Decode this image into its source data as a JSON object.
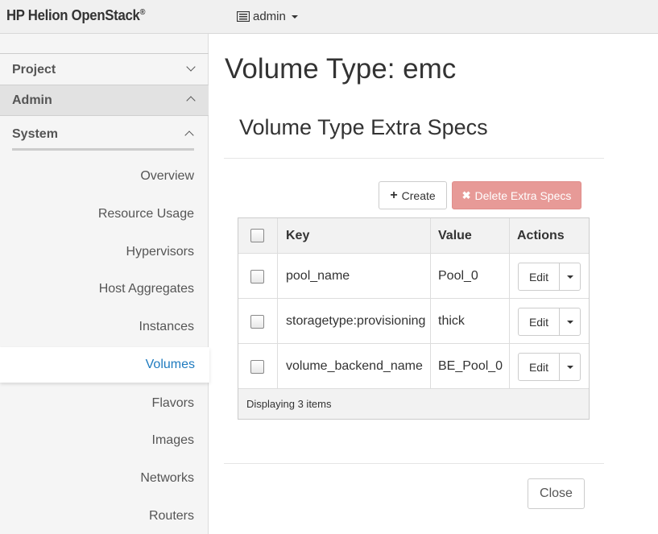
{
  "topbar": {
    "brand": "HP Helion OpenStack",
    "brand_mark": "®",
    "project_menu": "admin"
  },
  "sidebar": {
    "project_label": "Project",
    "admin_label": "Admin",
    "system_label": "System",
    "items": [
      {
        "label": "Overview",
        "active": false
      },
      {
        "label": "Resource Usage",
        "active": false
      },
      {
        "label": "Hypervisors",
        "active": false
      },
      {
        "label": "Host Aggregates",
        "active": false
      },
      {
        "label": "Instances",
        "active": false
      },
      {
        "label": "Volumes",
        "active": true
      },
      {
        "label": "Flavors",
        "active": false
      },
      {
        "label": "Images",
        "active": false
      },
      {
        "label": "Networks",
        "active": false
      },
      {
        "label": "Routers",
        "active": false
      }
    ]
  },
  "main": {
    "page_title": "Volume Type: emc",
    "modal_title": "Volume Type Extra Specs",
    "create_label": "Create",
    "delete_label": "Delete Extra Specs",
    "close_label": "Close"
  },
  "table": {
    "headers": {
      "key": "Key",
      "value": "Value",
      "actions": "Actions"
    },
    "rows": [
      {
        "key": "pool_name",
        "value": "Pool_0",
        "action": "Edit"
      },
      {
        "key": "storagetype:provisioning",
        "value": "thick",
        "action": "Edit"
      },
      {
        "key": "volume_backend_name",
        "value": "BE_Pool_0",
        "action": "Edit"
      }
    ],
    "footer": "Displaying 3 items"
  },
  "colors": {
    "active_link": "#1f7bbf",
    "danger_button": "#e79a97"
  }
}
